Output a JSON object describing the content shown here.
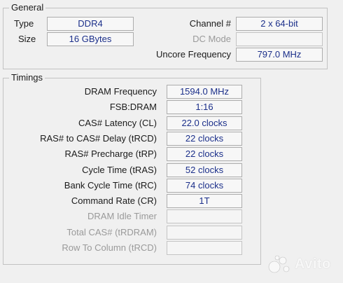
{
  "general": {
    "title": "General",
    "type_label": "Type",
    "type_value": "DDR4",
    "size_label": "Size",
    "size_value": "16 GBytes",
    "channel_label": "Channel #",
    "channel_value": "2 x 64-bit",
    "dcmode_label": "DC Mode",
    "dcmode_value": "",
    "uncore_label": "Uncore Frequency",
    "uncore_value": "797.0 MHz"
  },
  "timings": {
    "title": "Timings",
    "rows": [
      {
        "label": "DRAM Frequency",
        "value": "1594.0 MHz"
      },
      {
        "label": "FSB:DRAM",
        "value": "1:16"
      },
      {
        "label": "CAS# Latency (CL)",
        "value": "22.0 clocks"
      },
      {
        "label": "RAS# to CAS# Delay (tRCD)",
        "value": "22 clocks"
      },
      {
        "label": "RAS# Precharge (tRP)",
        "value": "22 clocks"
      },
      {
        "label": "Cycle Time (tRAS)",
        "value": "52 clocks"
      },
      {
        "label": "Bank Cycle Time (tRC)",
        "value": "74 clocks"
      },
      {
        "label": "Command Rate (CR)",
        "value": "1T"
      },
      {
        "label": "DRAM Idle Timer",
        "value": ""
      },
      {
        "label": "Total CAS# (tRDRAM)",
        "value": ""
      },
      {
        "label": "Row To Column (tRCD)",
        "value": ""
      }
    ]
  },
  "watermark": {
    "text": "Avito",
    "icon": "avito-logo-icon"
  }
}
